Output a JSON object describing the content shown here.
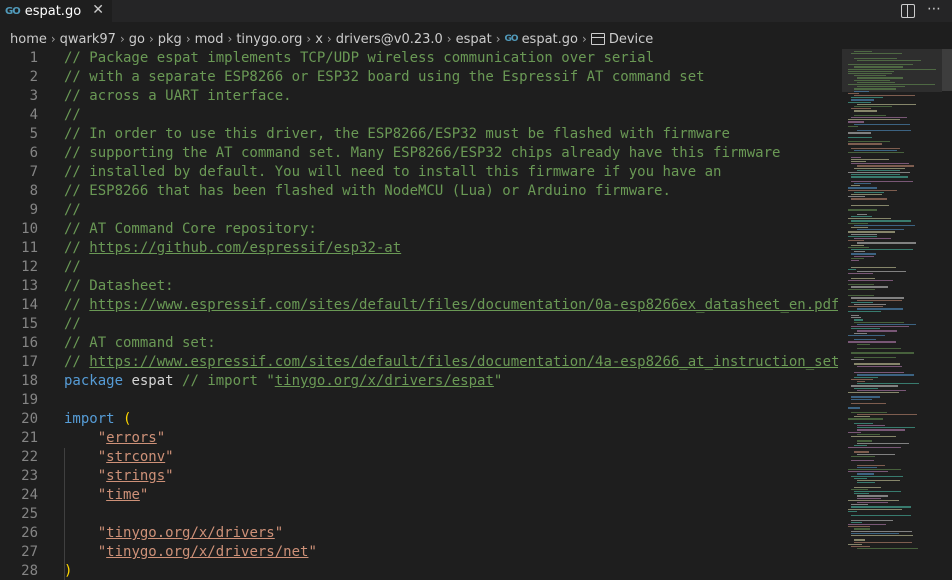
{
  "tab": {
    "icon": "go-file-icon",
    "icon_text": "GO",
    "label": "espat.go",
    "close": "✕"
  },
  "breadcrumb": {
    "items": [
      "home",
      "qwark97",
      "go",
      "pkg",
      "mod",
      "tinygo.org",
      "x",
      "drivers@v0.23.0",
      "espat"
    ],
    "file": "espat.go",
    "symbol": "Device"
  },
  "code_lines": [
    {
      "n": "1",
      "tokens": [
        {
          "t": "cmt",
          "v": "// Package espat implements TCP/UDP wireless communication over serial"
        }
      ]
    },
    {
      "n": "2",
      "tokens": [
        {
          "t": "cmt",
          "v": "// with a separate ESP8266 or ESP32 board using the Espressif AT command set"
        }
      ]
    },
    {
      "n": "3",
      "tokens": [
        {
          "t": "cmt",
          "v": "// across a UART interface."
        }
      ]
    },
    {
      "n": "4",
      "tokens": [
        {
          "t": "cmt",
          "v": "//"
        }
      ]
    },
    {
      "n": "5",
      "tokens": [
        {
          "t": "cmt",
          "v": "// In order to use this driver, the ESP8266/ESP32 must be flashed with firmware"
        }
      ]
    },
    {
      "n": "6",
      "tokens": [
        {
          "t": "cmt",
          "v": "// supporting the AT command set. Many ESP8266/ESP32 chips already have this firmware"
        }
      ]
    },
    {
      "n": "7",
      "tokens": [
        {
          "t": "cmt",
          "v": "// installed by default. You will need to install this firmware if you have an"
        }
      ]
    },
    {
      "n": "8",
      "tokens": [
        {
          "t": "cmt",
          "v": "// ESP8266 that has been flashed with NodeMCU (Lua) or Arduino firmware."
        }
      ]
    },
    {
      "n": "9",
      "tokens": [
        {
          "t": "cmt",
          "v": "//"
        }
      ]
    },
    {
      "n": "10",
      "tokens": [
        {
          "t": "cmt",
          "v": "// AT Command Core repository:"
        }
      ]
    },
    {
      "n": "11",
      "tokens": [
        {
          "t": "cmt",
          "v": "// "
        },
        {
          "t": "link",
          "v": "https://github.com/espressif/esp32-at"
        }
      ]
    },
    {
      "n": "12",
      "tokens": [
        {
          "t": "cmt",
          "v": "//"
        }
      ]
    },
    {
      "n": "13",
      "tokens": [
        {
          "t": "cmt",
          "v": "// Datasheet:"
        }
      ]
    },
    {
      "n": "14",
      "tokens": [
        {
          "t": "cmt",
          "v": "// "
        },
        {
          "t": "link",
          "v": "https://www.espressif.com/sites/default/files/documentation/0a-esp8266ex_datasheet_en.pdf"
        }
      ]
    },
    {
      "n": "15",
      "tokens": [
        {
          "t": "cmt",
          "v": "//"
        }
      ]
    },
    {
      "n": "16",
      "tokens": [
        {
          "t": "cmt",
          "v": "// AT command set:"
        }
      ]
    },
    {
      "n": "17",
      "tokens": [
        {
          "t": "cmt",
          "v": "// "
        },
        {
          "t": "link",
          "v": "https://www.espressif.com/sites/default/files/documentation/4a-esp8266_at_instruction_set"
        }
      ]
    },
    {
      "n": "18",
      "tokens": [
        {
          "t": "kw",
          "v": "package"
        },
        {
          "t": "ident",
          "v": " espat "
        },
        {
          "t": "cmt",
          "v": "// import \""
        },
        {
          "t": "link",
          "v": "tinygo.org/x/drivers/espat"
        },
        {
          "t": "cmt",
          "v": "\""
        }
      ]
    },
    {
      "n": "19",
      "tokens": []
    },
    {
      "n": "20",
      "tokens": [
        {
          "t": "kw",
          "v": "import"
        },
        {
          "t": "ident",
          "v": " "
        },
        {
          "t": "paren",
          "v": "("
        }
      ]
    },
    {
      "n": "21",
      "tokens": [
        {
          "t": "ident",
          "v": "    "
        },
        {
          "t": "str",
          "v": "\""
        },
        {
          "t": "strlink",
          "v": "errors"
        },
        {
          "t": "str",
          "v": "\""
        }
      ]
    },
    {
      "n": "22",
      "tokens": [
        {
          "t": "ident",
          "v": "    "
        },
        {
          "t": "str",
          "v": "\""
        },
        {
          "t": "strlink",
          "v": "strconv"
        },
        {
          "t": "str",
          "v": "\""
        }
      ]
    },
    {
      "n": "23",
      "tokens": [
        {
          "t": "ident",
          "v": "    "
        },
        {
          "t": "str",
          "v": "\""
        },
        {
          "t": "strlink",
          "v": "strings"
        },
        {
          "t": "str",
          "v": "\""
        }
      ]
    },
    {
      "n": "24",
      "tokens": [
        {
          "t": "ident",
          "v": "    "
        },
        {
          "t": "str",
          "v": "\""
        },
        {
          "t": "strlink",
          "v": "time"
        },
        {
          "t": "str",
          "v": "\""
        }
      ]
    },
    {
      "n": "25",
      "tokens": []
    },
    {
      "n": "26",
      "tokens": [
        {
          "t": "ident",
          "v": "    "
        },
        {
          "t": "str",
          "v": "\""
        },
        {
          "t": "strlink",
          "v": "tinygo.org/x/drivers"
        },
        {
          "t": "str",
          "v": "\""
        }
      ]
    },
    {
      "n": "27",
      "tokens": [
        {
          "t": "ident",
          "v": "    "
        },
        {
          "t": "str",
          "v": "\""
        },
        {
          "t": "strlink",
          "v": "tinygo.org/x/drivers/net"
        },
        {
          "t": "str",
          "v": "\""
        }
      ]
    },
    {
      "n": "28",
      "tokens": [
        {
          "t": "paren",
          "v": ")"
        }
      ]
    }
  ],
  "colors": {
    "background": "#1e1e1e",
    "comment": "#6a9955",
    "keyword": "#569cd6",
    "string": "#ce9178",
    "bracket": "#ffd700",
    "line_number": "#858585"
  },
  "icons": {
    "split": "split-editor-icon",
    "more": "more-actions-icon",
    "device": "symbol-structure-icon"
  }
}
